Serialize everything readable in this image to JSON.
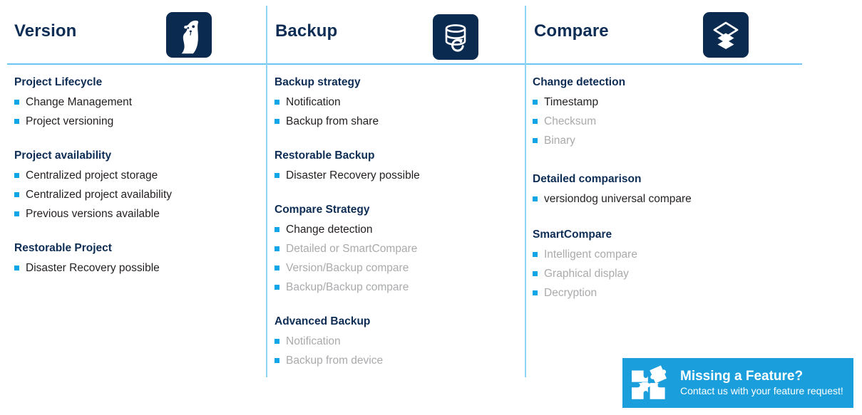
{
  "slide": {
    "columns": [
      {
        "title": "Version",
        "icon": "versiondog-dog-logo-icon",
        "groups": [
          {
            "title": "Project Lifecycle",
            "items": [
              {
                "label": "Change Management",
                "muted": false
              },
              {
                "label": "Project versioning",
                "muted": false
              }
            ]
          },
          {
            "title": "Project availability",
            "items": [
              {
                "label": "Centralized project storage",
                "muted": false
              },
              {
                "label": "Centralized project availability",
                "muted": false
              },
              {
                "label": "Previous versions available",
                "muted": false
              }
            ]
          },
          {
            "title": "Restorable Project",
            "items": [
              {
                "label": "Disaster Recovery possible",
                "muted": false
              }
            ]
          }
        ]
      },
      {
        "title": "Backup",
        "icon": "database-refresh-icon",
        "groups": [
          {
            "title": "Backup strategy",
            "items": [
              {
                "label": "Notification",
                "muted": false
              },
              {
                "label": "Backup from share",
                "muted": false
              }
            ]
          },
          {
            "title": "Restorable Backup",
            "items": [
              {
                "label": "Disaster Recovery possible",
                "muted": false
              }
            ]
          },
          {
            "title": "Compare Strategy",
            "items": [
              {
                "label": "Change detection",
                "muted": false
              },
              {
                "label": "Detailed or SmartCompare",
                "muted": true
              },
              {
                "label": "Version/Backup compare",
                "muted": true
              },
              {
                "label": "Backup/Backup compare",
                "muted": true
              }
            ]
          },
          {
            "title": "Advanced Backup",
            "items": [
              {
                "label": "Notification",
                "muted": true
              },
              {
                "label": "Backup from device",
                "muted": true
              }
            ]
          }
        ]
      },
      {
        "title": "Compare",
        "icon": "layers-stack-icon",
        "groups": [
          {
            "title": "Change detection",
            "items": [
              {
                "label": "Timestamp",
                "muted": false
              },
              {
                "label": "Checksum",
                "muted": true
              },
              {
                "label": "Binary",
                "muted": true
              }
            ]
          },
          {
            "title": "Detailed comparison",
            "items": [
              {
                "label": "versiondog universal compare",
                "muted": false
              }
            ]
          },
          {
            "title": "SmartCompare",
            "items": [
              {
                "label": "Intelligent compare",
                "muted": true
              },
              {
                "label": "Graphical display",
                "muted": true
              },
              {
                "label": "Decryption",
                "muted": true
              }
            ]
          }
        ]
      }
    ]
  },
  "banner": {
    "icon": "puzzle-pieces-icon",
    "title": "Missing a Feature?",
    "subtitle": "Contact us with your feature request!"
  },
  "colors": {
    "headline_navy": "#0E2D54",
    "icon_tile_navy": "#0B2A4F",
    "bullet_blue": "#0FA6E8",
    "rule_blue": "#6EC6F5",
    "divider_blue": "#8FD3F7",
    "body_text": "#231F20",
    "muted_text": "#A9AAAC",
    "banner_blue": "#1B9FDC",
    "background": "#FFFFFF"
  }
}
